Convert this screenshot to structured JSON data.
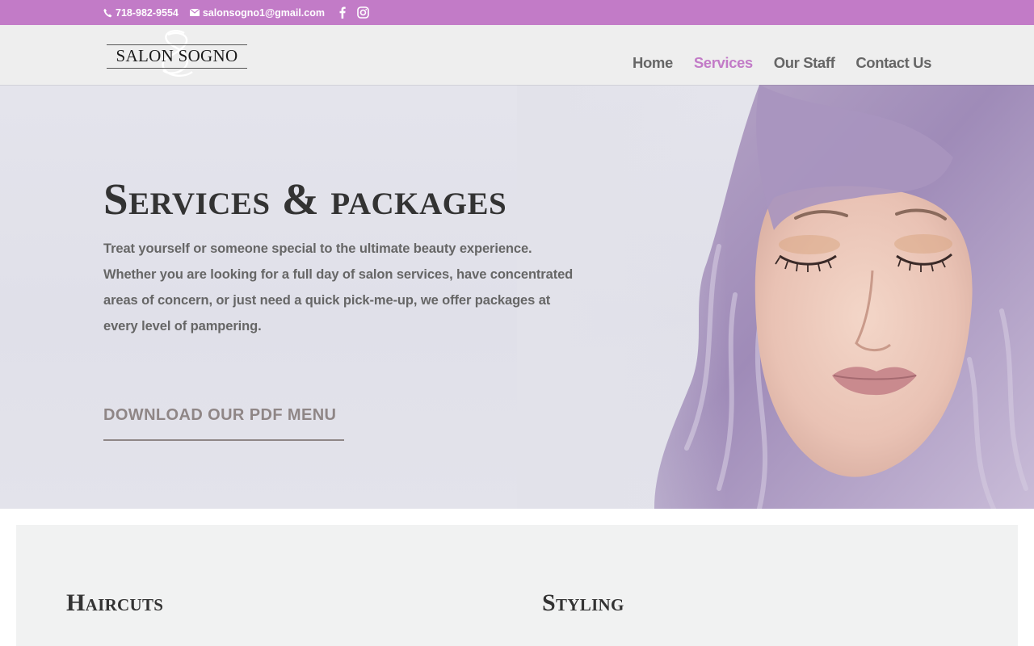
{
  "topbar": {
    "phone": "718-982-9554",
    "email": "salonsogno1@gmail.com",
    "social": [
      "facebook-icon",
      "instagram-icon"
    ]
  },
  "header": {
    "logo_text": "SALON SOGNO",
    "nav": [
      {
        "label": "Home",
        "active": false
      },
      {
        "label": "Services",
        "active": true
      },
      {
        "label": "Our Staff",
        "active": false
      },
      {
        "label": "Contact Us",
        "active": false
      }
    ]
  },
  "hero": {
    "title": "Services & packages",
    "text": "Treat yourself or someone special to the ultimate beauty experience. Whether you are looking for a full day of salon services, have concentrated areas of concern, or just need a quick pick-me-up, we offer packages at every level of pampering.",
    "button_label": "DOWNLOAD OUR PDF MENU"
  },
  "services": {
    "columns": [
      {
        "title": "Haircuts"
      },
      {
        "title": "Styling"
      }
    ]
  },
  "colors": {
    "accent": "#c27bc7",
    "header_bg": "#eeeeee",
    "hero_bg": "#e2e2ea",
    "text": "#666666",
    "heading": "#333333",
    "button": "#8f8686",
    "section_bg": "#f1f2f2"
  }
}
